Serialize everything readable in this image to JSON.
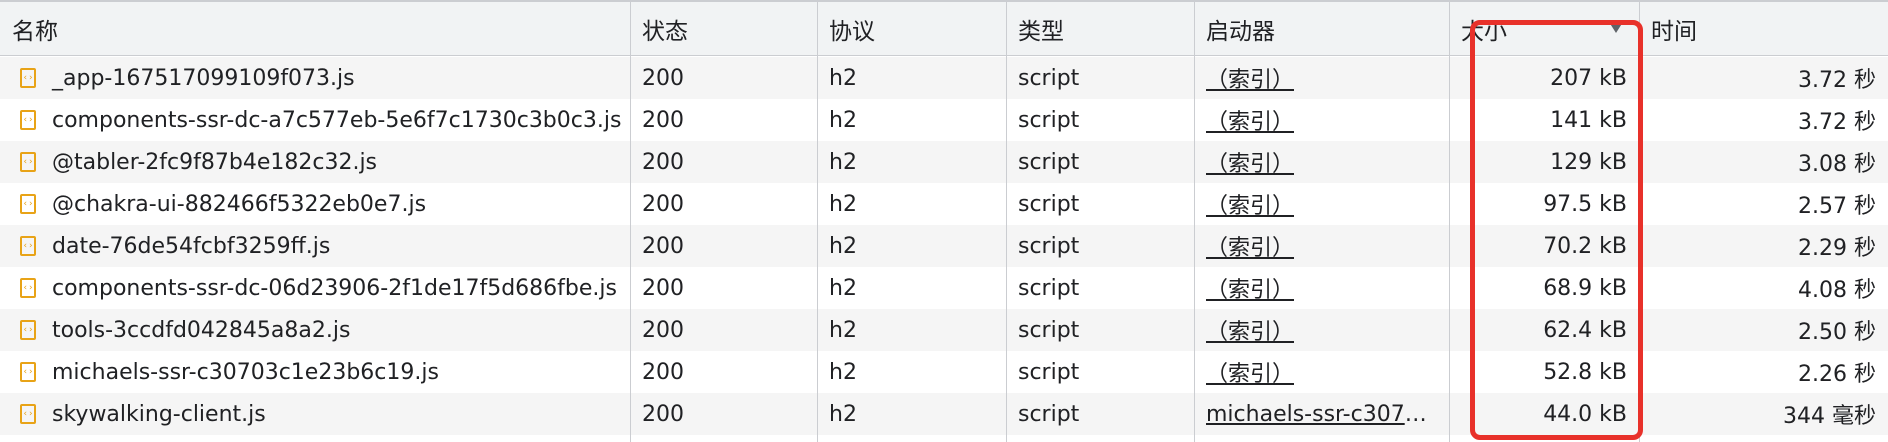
{
  "columns": {
    "name": "名称",
    "status": "状态",
    "protocol": "协议",
    "type": "类型",
    "initiator": "启动器",
    "size": "大小",
    "time": "时间"
  },
  "rows": [
    {
      "name": "_app-167517099109f073.js",
      "status": "200",
      "protocol": "h2",
      "type": "script",
      "initiator": "（索引）",
      "size": "207 kB",
      "time": "3.72 秒"
    },
    {
      "name": "components-ssr-dc-a7c577eb-5e6f7c1730c3b0c3.js",
      "status": "200",
      "protocol": "h2",
      "type": "script",
      "initiator": "（索引）",
      "size": "141 kB",
      "time": "3.72 秒"
    },
    {
      "name": "@tabler-2fc9f87b4e182c32.js",
      "status": "200",
      "protocol": "h2",
      "type": "script",
      "initiator": "（索引）",
      "size": "129 kB",
      "time": "3.08 秒"
    },
    {
      "name": "@chakra-ui-882466f5322eb0e7.js",
      "status": "200",
      "protocol": "h2",
      "type": "script",
      "initiator": "（索引）",
      "size": "97.5 kB",
      "time": "2.57 秒"
    },
    {
      "name": "date-76de54fcbf3259ff.js",
      "status": "200",
      "protocol": "h2",
      "type": "script",
      "initiator": "（索引）",
      "size": "70.2 kB",
      "time": "2.29 秒"
    },
    {
      "name": "components-ssr-dc-06d23906-2f1de17f5d686fbe.js",
      "status": "200",
      "protocol": "h2",
      "type": "script",
      "initiator": "（索引）",
      "size": "68.9 kB",
      "time": "4.08 秒"
    },
    {
      "name": "tools-3ccdfd042845a8a2.js",
      "status": "200",
      "protocol": "h2",
      "type": "script",
      "initiator": "（索引）",
      "size": "62.4 kB",
      "time": "2.50 秒"
    },
    {
      "name": "michaels-ssr-c30703c1e23b6c19.js",
      "status": "200",
      "protocol": "h2",
      "type": "script",
      "initiator": "（索引）",
      "size": "52.8 kB",
      "time": "2.26 秒"
    },
    {
      "name": "skywalking-client.js",
      "status": "200",
      "protocol": "h2",
      "type": "script",
      "initiator": "michaels-ssr-c3070…",
      "size": "44.0 kB",
      "time": "344 毫秒"
    }
  ],
  "colors": {
    "highlight": "#e8312a",
    "file_icon": "#e8a317"
  },
  "icons": {
    "file": "script-file-icon",
    "sort": "sort-descending-icon"
  }
}
